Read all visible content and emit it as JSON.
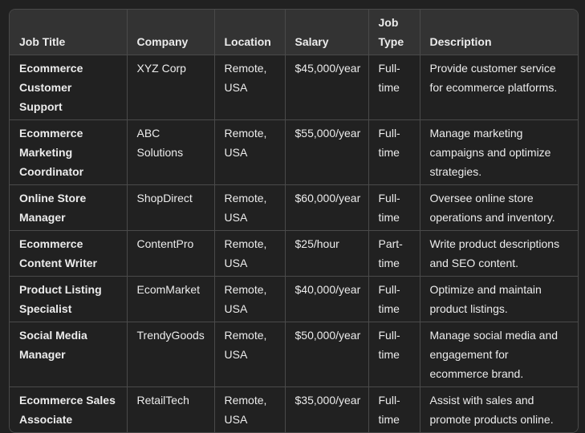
{
  "table": {
    "headers": [
      "Job Title",
      "Company",
      "Location",
      "Salary",
      "Job Type",
      "Description"
    ],
    "rows": [
      [
        "Ecommerce Customer Support",
        "XYZ Corp",
        "Remote, USA",
        "$45,000/year",
        "Full-time",
        "Provide customer service for ecommerce platforms."
      ],
      [
        "Ecommerce Marketing Coordinator",
        "ABC Solutions",
        "Remote, USA",
        "$55,000/year",
        "Full-time",
        "Manage marketing campaigns and optimize strategies."
      ],
      [
        "Online Store Manager",
        "ShopDirect",
        "Remote, USA",
        "$60,000/year",
        "Full-time",
        "Oversee online store operations and inventory."
      ],
      [
        "Ecommerce Content Writer",
        "ContentPro",
        "Remote, USA",
        "$25/hour",
        "Part-time",
        "Write product descriptions and SEO content."
      ],
      [
        "Product Listing Specialist",
        "EcomMarket",
        "Remote, USA",
        "$40,000/year",
        "Full-time",
        "Optimize and maintain product listings."
      ],
      [
        "Social Media Manager",
        "TrendyGoods",
        "Remote, USA",
        "$50,000/year",
        "Full-time",
        "Manage social media and engagement for ecommerce brand."
      ],
      [
        "Ecommerce Sales Associate",
        "RetailTech",
        "Remote, USA",
        "$35,000/year",
        "Full-time",
        "Assist with sales and promote products online."
      ]
    ]
  }
}
